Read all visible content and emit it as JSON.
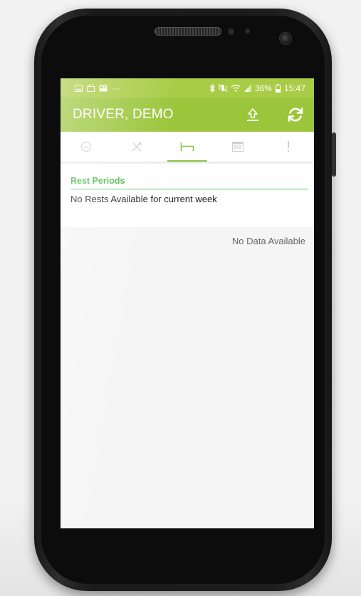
{
  "status_bar": {
    "left_icons": [
      "image-icon",
      "bag-icon",
      "cast-icon",
      "more-icon"
    ],
    "more": "···",
    "battery_percent": "36%",
    "time": "15:47"
  },
  "app_bar": {
    "title": "DRIVER, DEMO"
  },
  "tabs": [
    {
      "icon": "gauge-icon",
      "active": false
    },
    {
      "icon": "tools-icon",
      "active": false
    },
    {
      "icon": "bed-icon",
      "active": true
    },
    {
      "icon": "calendar-icon",
      "active": false
    },
    {
      "icon": "alert-icon",
      "active": false
    }
  ],
  "section": {
    "title": "Rest Periods",
    "empty_message": "No Rests Available for current week"
  },
  "no_data": "No Data Available",
  "colors": {
    "status_bar": "#a8cc45",
    "app_bar": "#9bc63b",
    "accent": "#5cc65a"
  }
}
